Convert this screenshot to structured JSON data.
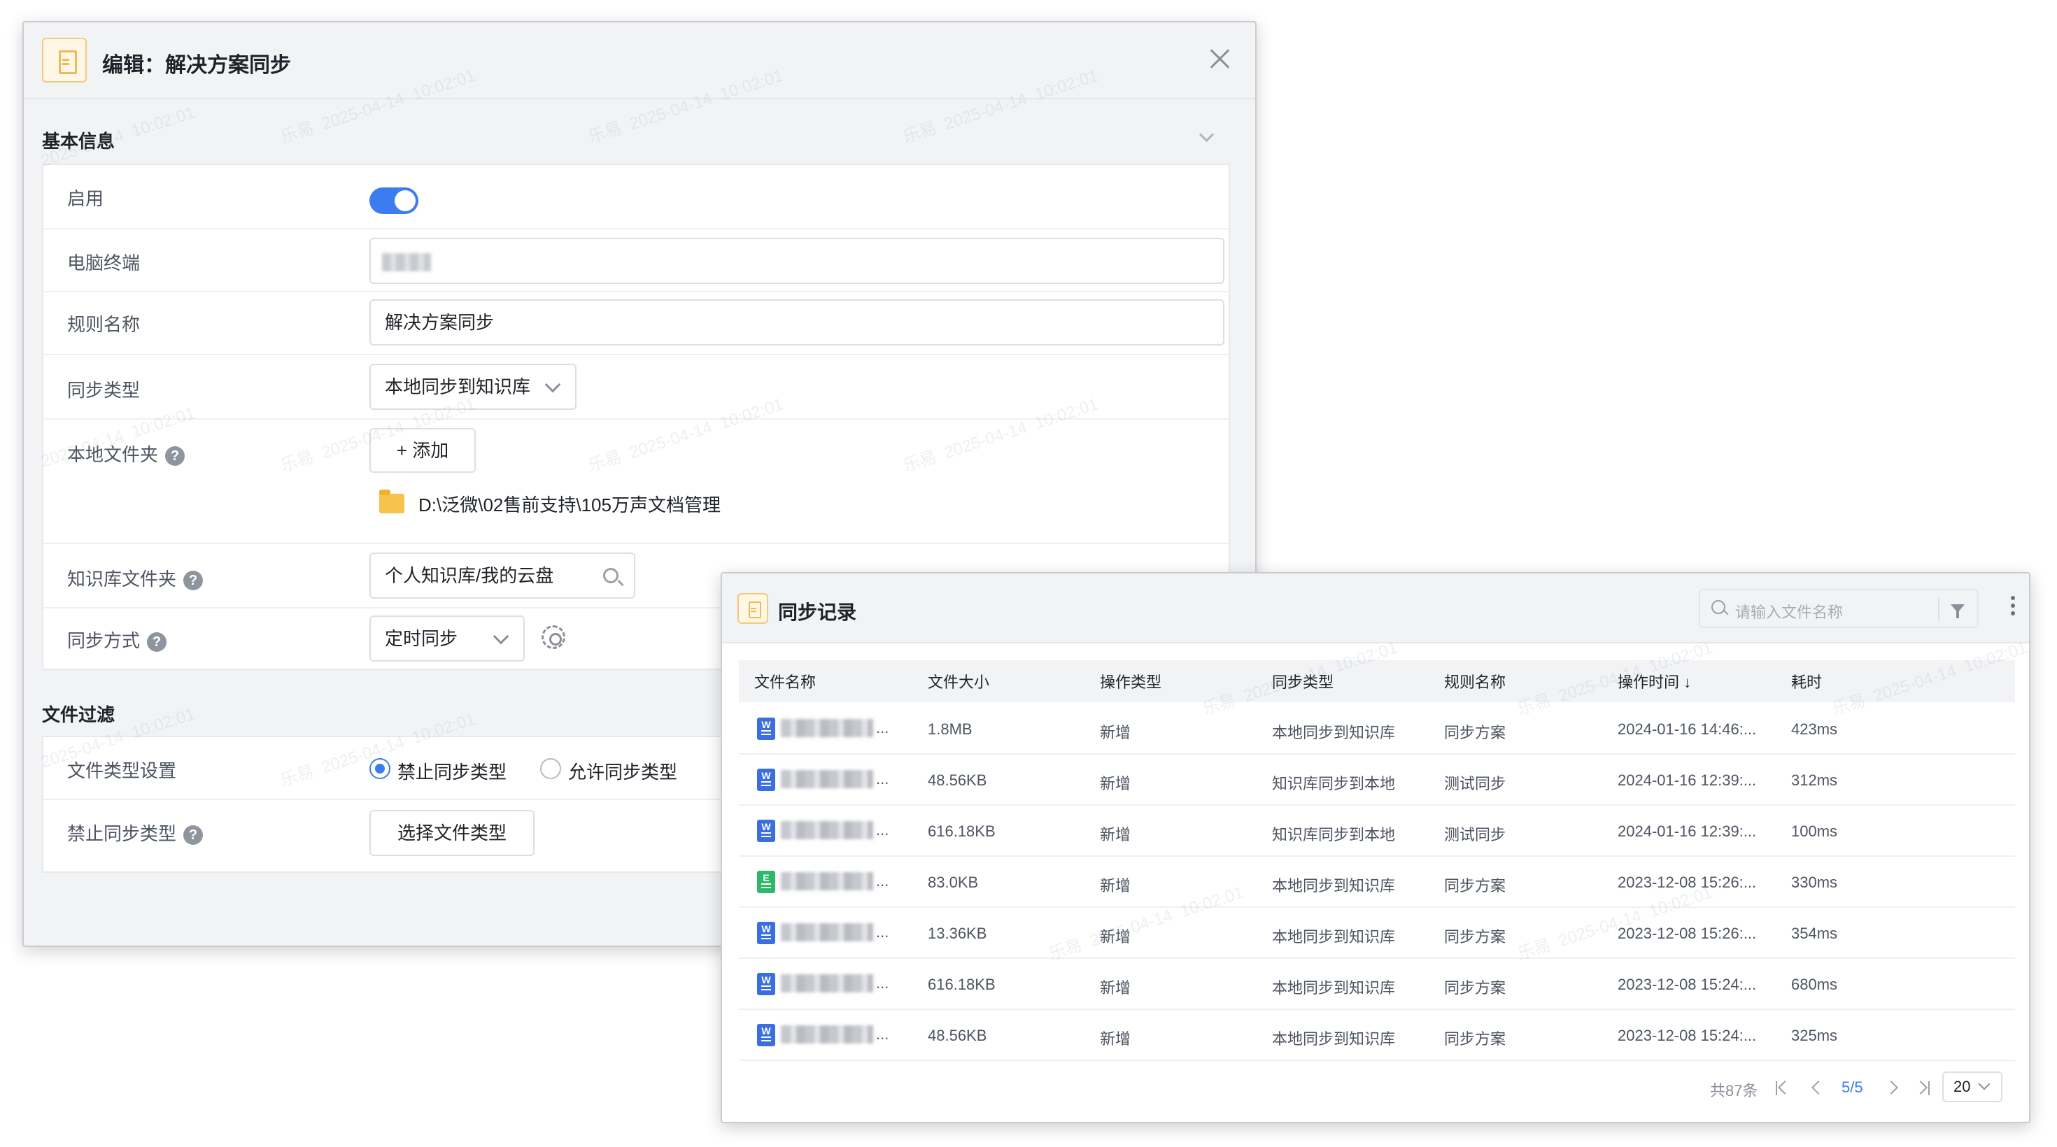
{
  "editor": {
    "title": "编辑：解决方案同步",
    "section_basic": "基本信息",
    "section_filter": "文件过滤",
    "fields": {
      "enable_label": "启用",
      "enable_value": true,
      "terminal_label": "电脑终端",
      "rule_name_label": "规则名称",
      "rule_name_value": "解决方案同步",
      "sync_type_label": "同步类型",
      "sync_type_value": "本地同步到知识库",
      "local_folder_label": "本地文件夹",
      "add_button": "+ 添加",
      "local_folder_path": "D:\\泛微\\02售前支持\\105万声文档管理",
      "kb_folder_label": "知识库文件夹",
      "kb_folder_value": "个人知识库/我的云盘",
      "sync_mode_label": "同步方式",
      "sync_mode_value": "定时同步",
      "file_type_label": "文件类型设置",
      "radio_block": "禁止同步类型",
      "radio_allow": "允许同步类型",
      "block_types_label": "禁止同步类型",
      "choose_types_button": "选择文件类型"
    }
  },
  "records": {
    "title": "同步记录",
    "search_placeholder": "请输入文件名称",
    "columns": [
      "文件名称",
      "文件大小",
      "操作类型",
      "同步类型",
      "规则名称",
      "操作时间 ↓",
      "耗时"
    ],
    "rows": [
      {
        "icon": "W",
        "type": "doc",
        "name_suffix": "...",
        "size": "1.8MB",
        "op": "新增",
        "sync": "本地同步到知识库",
        "rule": "同步方案",
        "time": "2024-01-16 14:46:...",
        "cost": "423ms"
      },
      {
        "icon": "W",
        "type": "doc",
        "name_suffix": "...",
        "size": "48.56KB",
        "op": "新增",
        "sync": "知识库同步到本地",
        "rule": "测试同步",
        "time": "2024-01-16 12:39:...",
        "cost": "312ms"
      },
      {
        "icon": "W",
        "type": "doc",
        "name_suffix": "...",
        "size": "616.18KB",
        "op": "新增",
        "sync": "知识库同步到本地",
        "rule": "测试同步",
        "time": "2024-01-16 12:39:...",
        "cost": "100ms"
      },
      {
        "icon": "E",
        "type": "xls",
        "name_suffix": "...",
        "size": "83.0KB",
        "op": "新增",
        "sync": "本地同步到知识库",
        "rule": "同步方案",
        "time": "2023-12-08 15:26:...",
        "cost": "330ms"
      },
      {
        "icon": "W",
        "type": "doc",
        "name_suffix": "...",
        "size": "13.36KB",
        "op": "新增",
        "sync": "本地同步到知识库",
        "rule": "同步方案",
        "time": "2023-12-08 15:26:...",
        "cost": "354ms"
      },
      {
        "icon": "W",
        "type": "doc",
        "name_suffix": "...",
        "size": "616.18KB",
        "op": "新增",
        "sync": "本地同步到知识库",
        "rule": "同步方案",
        "time": "2023-12-08 15:24:...",
        "cost": "680ms"
      },
      {
        "icon": "W",
        "type": "doc",
        "name_suffix": "...",
        "size": "48.56KB",
        "op": "新增",
        "sync": "本地同步到知识库",
        "rule": "同步方案",
        "time": "2023-12-08 15:24:...",
        "cost": "325ms"
      }
    ],
    "pager": {
      "total": "共87条",
      "current": "5/5",
      "page_size": "20"
    }
  },
  "watermark": {
    "name": "乐易",
    "date": "2025-04-14",
    "time": "10:02:01"
  },
  "colors": {
    "accent": "#3b7cf0",
    "folder": "#f7c34a",
    "doc_icon": "#3b6fe0",
    "xls_icon": "#2fb86a"
  }
}
